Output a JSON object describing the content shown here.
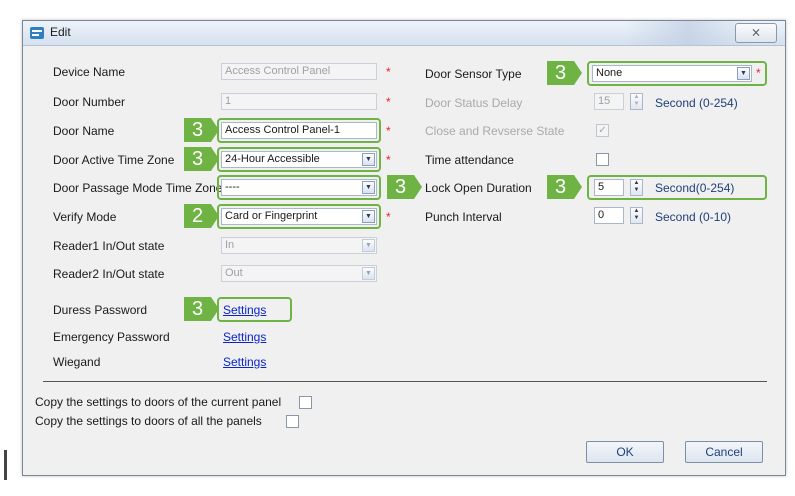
{
  "window": {
    "title": "Edit",
    "close_label": "⨯",
    "title_icon": "edit-form-icon"
  },
  "left": {
    "device_name": {
      "label": "Device Name",
      "value": "Access Control Panel",
      "required": "*"
    },
    "door_number": {
      "label": "Door Number",
      "value": "1",
      "required": "*"
    },
    "door_name": {
      "label": "Door Name",
      "value": "Access Control Panel-1",
      "required": "*",
      "step": "3"
    },
    "active_time_zone": {
      "label": "Door Active Time Zone",
      "value": "24-Hour Accessible",
      "required": "*",
      "step": "3"
    },
    "passage_mode": {
      "label": "Door Passage Mode Time Zone",
      "value": "----",
      "step": "3"
    },
    "verify_mode": {
      "label": "Verify Mode",
      "value": "Card or Fingerprint",
      "required": "*",
      "step": "2"
    },
    "reader1": {
      "label": "Reader1 In/Out state",
      "value": "In"
    },
    "reader2": {
      "label": "Reader2 In/Out state",
      "value": "Out"
    },
    "duress": {
      "label": "Duress Password",
      "link": "Settings",
      "step": "3"
    },
    "emergency": {
      "label": "Emergency Password",
      "link": "Settings"
    },
    "wiegand": {
      "label": "Wiegand",
      "link": "Settings"
    }
  },
  "right": {
    "sensor_type": {
      "label": "Door Sensor Type",
      "value": "None",
      "required": "*",
      "step": "3"
    },
    "status_delay": {
      "label": "Door Status Delay",
      "value": "15",
      "unit": "Second (0-254)"
    },
    "close_reverse": {
      "label": "Close and Revserse State",
      "checked": true
    },
    "time_attendance": {
      "label": "Time attendance",
      "checked": false
    },
    "lock_open": {
      "label": "Lock Open Duration",
      "value": "5",
      "unit": "Second(0-254)",
      "step": "3"
    },
    "punch_interval": {
      "label": "Punch Interval",
      "value": "0",
      "unit": "Second (0-10)"
    }
  },
  "copy": {
    "current_panel": "Copy the settings to doors of the current panel",
    "all_panels": "Copy the settings to doors of all the panels"
  },
  "buttons": {
    "ok": "OK",
    "cancel": "Cancel"
  },
  "colors": {
    "highlight": "#6fb344",
    "required": "#e8232a",
    "link": "#0a24c8",
    "unit_text": "#1f3f7a"
  }
}
